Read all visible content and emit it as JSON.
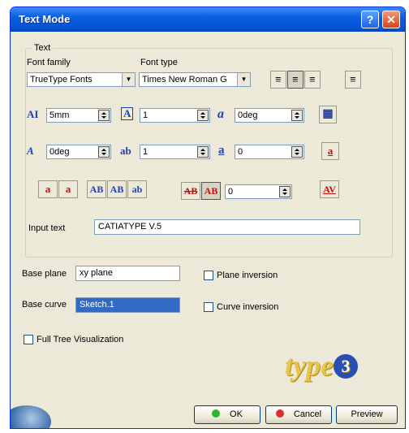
{
  "window": {
    "title": "Text Mode",
    "help_glyph": "?",
    "close_glyph": "✕"
  },
  "text_group": {
    "legend": "Text",
    "font_family_label": "Font family",
    "font_family_value": "TrueType Fonts",
    "font_type_label": "Font type",
    "font_type_value": "Times New Roman G",
    "align_left_glyph": "≡",
    "align_center_glyph": "≡",
    "align_right_glyph": "≡",
    "justify_glyph": "≡",
    "height_icon": "AI",
    "height_value": "5mm",
    "ratio_icon": "A",
    "ratio_value": "1",
    "slant_icon": "a",
    "slant_value": "0deg",
    "calc_glyph": "▦",
    "angle_icon": "A",
    "angle_value": "0deg",
    "spacing_icon": "ab",
    "spacing_value": "1",
    "underline_icon": "a",
    "underline_value": "0",
    "color_icon": "a",
    "superscript_icon": "a",
    "subscript_icon": "a",
    "style_ab1": "AB",
    "style_ab2": "AB",
    "style_ab3": "ab",
    "strike_ab1": "AB",
    "strike_ab2": "AB",
    "strike_value": "0",
    "kerning_icon": "AV",
    "input_text_label": "Input text",
    "input_text_value": "CATIATYPE V.5"
  },
  "base": {
    "plane_label": "Base plane",
    "plane_value": "xy plane",
    "curve_label": "Base curve",
    "curve_value": "Sketch.1",
    "plane_inversion_label": "Plane inversion",
    "curve_inversion_label": "Curve inversion",
    "full_tree_label": "Full Tree Visualization"
  },
  "logo": {
    "text": "type",
    "number": "3"
  },
  "buttons": {
    "ok": "OK",
    "cancel": "Cancel",
    "preview": "Preview"
  },
  "colors": {
    "ok_dot": "#2cb82c",
    "cancel_dot": "#d83030",
    "selected": "#316ac5"
  }
}
